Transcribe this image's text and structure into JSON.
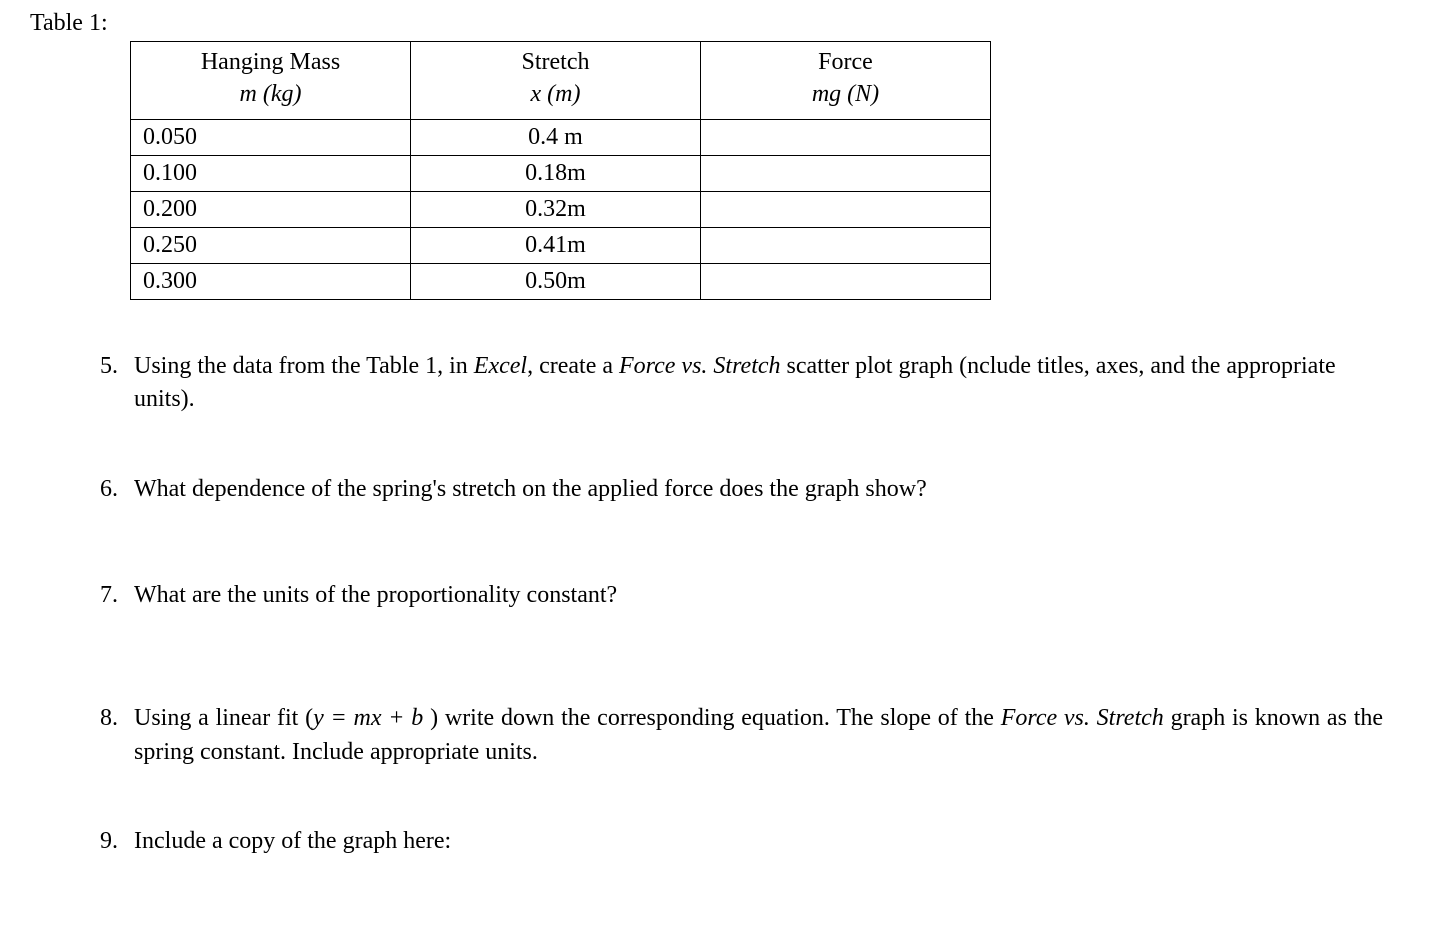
{
  "table": {
    "label": "Table 1:",
    "headers": {
      "mass": {
        "line1": "Hanging Mass",
        "line2": "m (kg)"
      },
      "stretch": {
        "line1": "Stretch",
        "line2": "x (m)"
      },
      "force": {
        "line1": "Force",
        "line2": "mg (N)"
      }
    },
    "rows": [
      {
        "mass": "0.050",
        "stretch": "0.4 m",
        "force": ""
      },
      {
        "mass": "0.100",
        "stretch": "0.18m",
        "force": ""
      },
      {
        "mass": "0.200",
        "stretch": "0.32m",
        "force": ""
      },
      {
        "mass": "0.250",
        "stretch": "0.41m",
        "force": ""
      },
      {
        "mass": "0.300",
        "stretch": "0.50m",
        "force": ""
      }
    ]
  },
  "questions": {
    "q5": {
      "number": "5.",
      "pre": "Using the data from the Table 1, in ",
      "ital1": "Excel",
      "mid": ", create a ",
      "ital2": "Force vs.  Stretch",
      "post": " scatter plot graph (nclude titles, axes, and the appropriate units)."
    },
    "q6": {
      "number": "6.",
      "text": "What dependence of the spring's stretch on the applied force does the graph show?"
    },
    "q7": {
      "number": "7.",
      "text": "What are the units of the proportionality constant?"
    },
    "q8": {
      "number": "8.",
      "pre": "Using  a  linear  fit  (",
      "ital1": "y  =  mx  +  b ",
      "mid": ")  write  down  the  corresponding  equation.  The  slope  of  the ",
      "ital2": "Force vs. Stretch",
      "post": " graph is known as the spring constant. Include appropriate units."
    },
    "q9": {
      "number": "9.",
      "text": "Include a copy of the graph here:"
    }
  },
  "chart_data": {
    "type": "table",
    "title": "Table 1",
    "columns": [
      "Hanging Mass m (kg)",
      "Stretch x (m)",
      "Force mg (N)"
    ],
    "rows": [
      [
        0.05,
        0.4,
        null
      ],
      [
        0.1,
        0.18,
        null
      ],
      [
        0.2,
        0.32,
        null
      ],
      [
        0.25,
        0.41,
        null
      ],
      [
        0.3,
        0.5,
        null
      ]
    ]
  }
}
